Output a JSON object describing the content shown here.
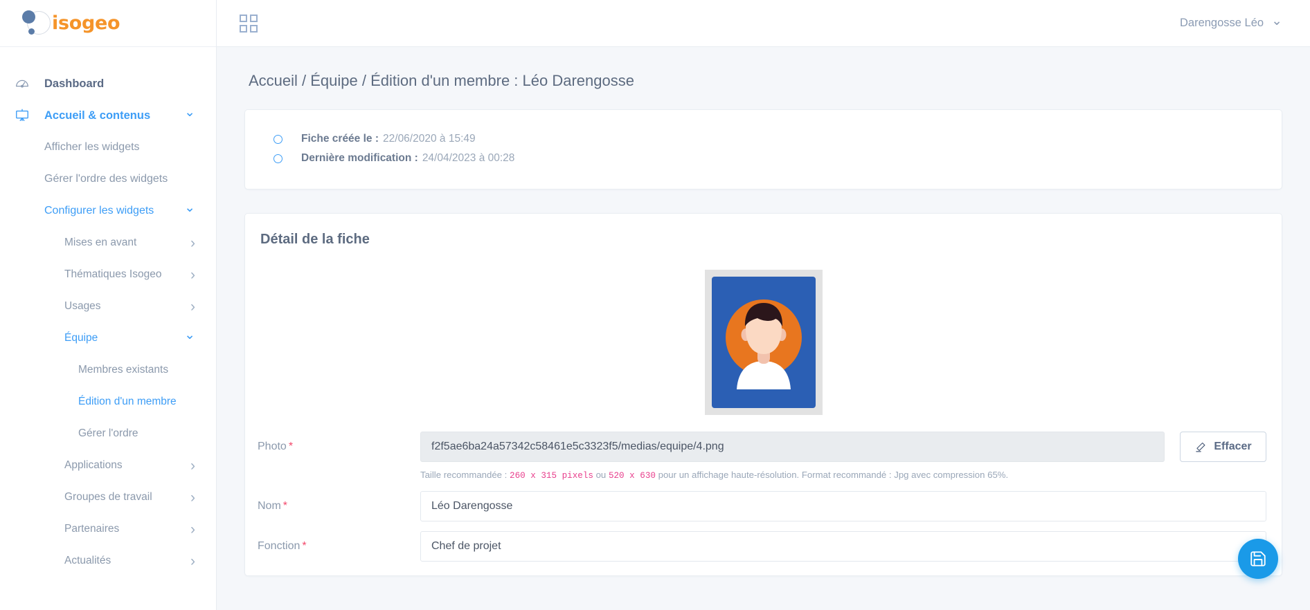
{
  "brand": {
    "name": "isogeo"
  },
  "topbar": {
    "apps_icon": "grid-icon",
    "user_name": "Darengosse Léo",
    "caret_icon": "chevron-down-icon"
  },
  "sidebar": {
    "items": [
      {
        "label": "Dashboard",
        "level": "top",
        "icon": "dashboard-gauge-icon",
        "state": "muted",
        "chevron": ""
      },
      {
        "label": "Accueil & contenus",
        "level": "top",
        "icon": "presentation-board-icon",
        "state": "active",
        "chevron": "down"
      },
      {
        "label": "Afficher les widgets",
        "level": "sub1",
        "state": "muted",
        "chevron": ""
      },
      {
        "label": "Gérer l'ordre des widgets",
        "level": "sub1",
        "state": "muted",
        "chevron": ""
      },
      {
        "label": "Configurer les widgets",
        "level": "sub1",
        "state": "active",
        "chevron": "down"
      },
      {
        "label": "Mises en avant",
        "level": "sub2",
        "state": "muted",
        "chevron": "right"
      },
      {
        "label": "Thématiques Isogeo",
        "level": "sub2",
        "state": "muted",
        "chevron": "right"
      },
      {
        "label": "Usages",
        "level": "sub2",
        "state": "muted",
        "chevron": "right"
      },
      {
        "label": "Équipe",
        "level": "sub2",
        "state": "active",
        "chevron": "down"
      },
      {
        "label": "Membres existants",
        "level": "sub3",
        "state": "muted",
        "chevron": ""
      },
      {
        "label": "Édition d'un membre",
        "level": "sub3",
        "state": "active",
        "chevron": ""
      },
      {
        "label": "Gérer l'ordre",
        "level": "sub3",
        "state": "muted",
        "chevron": ""
      },
      {
        "label": "Applications",
        "level": "sub2",
        "state": "muted",
        "chevron": "right"
      },
      {
        "label": "Groupes de travail",
        "level": "sub2",
        "state": "muted",
        "chevron": "right"
      },
      {
        "label": "Partenaires",
        "level": "sub2",
        "state": "muted",
        "chevron": "right"
      },
      {
        "label": "Actualités",
        "level": "sub2",
        "state": "muted",
        "chevron": "right"
      }
    ]
  },
  "page": {
    "breadcrumb": "Accueil / Équipe / Édition d'un membre : Léo Darengosse"
  },
  "info_card": {
    "rows": [
      {
        "label": "Fiche créée le :",
        "value": "22/06/2020 à 15:49"
      },
      {
        "label": "Dernière modification :",
        "value": "24/04/2023 à 00:28"
      }
    ]
  },
  "detail_card": {
    "title": "Détail de la fiche",
    "photo": {
      "label": "Photo",
      "required": "*",
      "value": "f2f5ae6ba24a57342c58461e5c3323f5/medias/equipe/4.png",
      "erase_label": "Effacer",
      "erase_icon": "eraser-icon",
      "helper_prefix": "Taille recommandée : ",
      "helper_size_1": "260 x 315 pixels",
      "helper_mid": " ou ",
      "helper_size_2": "520 x 630",
      "helper_suffix": " pour un affichage haute-résolution. Format recommandé : Jpg avec compression 65%."
    },
    "fields": [
      {
        "label": "Nom",
        "required": "*",
        "value": "Léo Darengosse"
      },
      {
        "label": "Fonction",
        "required": "*",
        "value": "Chef de projet"
      }
    ]
  },
  "fab": {
    "icon": "save-floppy-icon",
    "color": "#1a9ae8"
  }
}
